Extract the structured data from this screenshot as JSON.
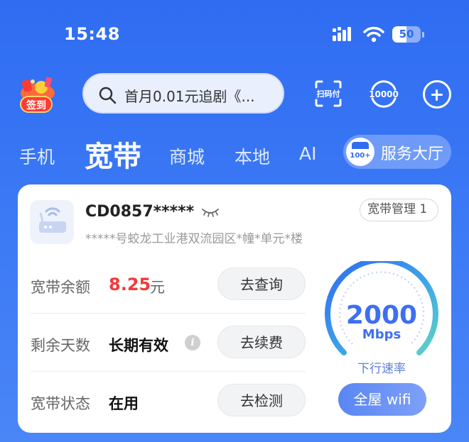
{
  "status_bar": {
    "time": "15:48",
    "battery": "50",
    "battery_level": 0.5
  },
  "top_bar": {
    "signin_label": "签到",
    "search_placeholder": "首月0.01元追剧《...",
    "scan_pay_label": "扫码付",
    "service_label": "10000"
  },
  "tabs": [
    {
      "label": "手机",
      "active": false
    },
    {
      "label": "宽带",
      "active": true
    },
    {
      "label": "商城",
      "active": false
    },
    {
      "label": "本地",
      "active": false
    },
    {
      "label": "AI",
      "active": false
    }
  ],
  "service_hall": {
    "badge": "100+",
    "label": "服务大厅"
  },
  "broadband_card": {
    "account": "CD0857*****",
    "manage_label": "宽带管理 1",
    "address": "*****号蛟龙工业港双流园区*幢*单元*楼",
    "rows": [
      {
        "label": "宽带余额",
        "value": "8.25",
        "unit": "元",
        "button": "去查询"
      },
      {
        "label": "剩余天数",
        "value": "长期有效",
        "info_icon": "i",
        "button": "去续费"
      },
      {
        "label": "宽带状态",
        "value": "在用",
        "button": "去检测"
      }
    ],
    "speed": {
      "value": "2000",
      "unit": "Mbps",
      "label": "下行速率"
    },
    "wifi_button": "全屋 wifi"
  },
  "colors": {
    "background": "#2f6cf2",
    "accent_red": "#f23a3a",
    "gauge_blue": "#3d6ff0",
    "gauge_green": "#5fd3c4"
  }
}
